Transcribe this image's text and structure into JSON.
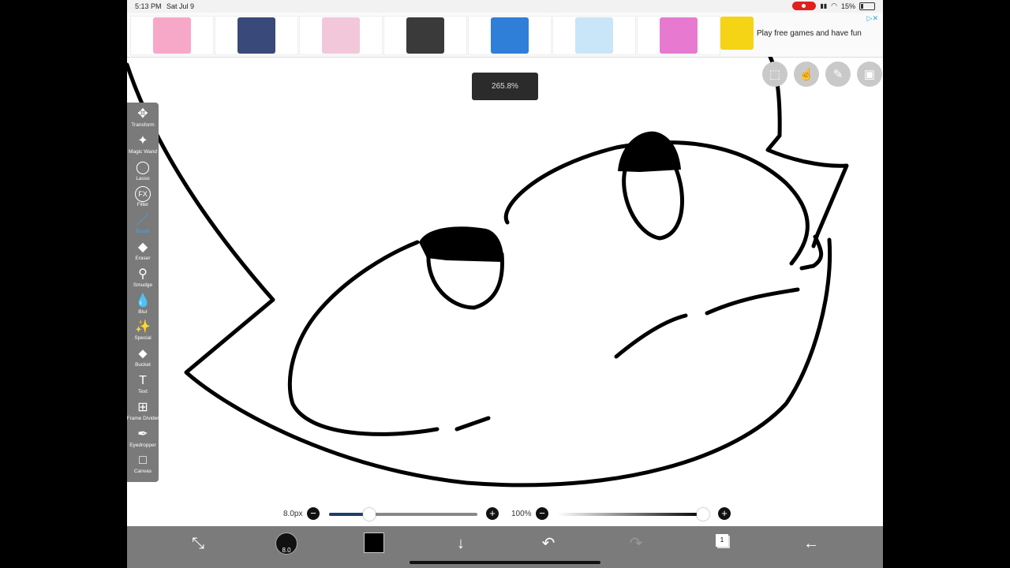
{
  "status": {
    "time": "5:13 PM",
    "date": "Sat Jul 9",
    "battery": "15%"
  },
  "ad": {
    "text": "Play free games and have fun",
    "info_glyph": "▷✕",
    "thumbs": [
      {
        "name": "peppa-pig-game",
        "color": "#f7a8c8"
      },
      {
        "name": "ladybug-game",
        "color": "#394a7a"
      },
      {
        "name": "dolls-game",
        "color": "#f2c7d9"
      },
      {
        "name": "dino-game",
        "color": "#3a3a3a"
      },
      {
        "name": "penguin-game",
        "color": "#2f7fd8"
      },
      {
        "name": "water-glass-game",
        "color": "#c8e6f7"
      },
      {
        "name": "house-game",
        "color": "#e77ad0"
      }
    ]
  },
  "canvas": {
    "zoom": "265.8%"
  },
  "topright": [
    {
      "name": "selection-icon",
      "glyph": "⬚"
    },
    {
      "name": "hand-icon",
      "glyph": "☝"
    },
    {
      "name": "pencil-icon",
      "glyph": "✎"
    },
    {
      "name": "image-icon",
      "glyph": "▣"
    }
  ],
  "tools": [
    {
      "id": "transform",
      "label": "Transform",
      "icon": "✥"
    },
    {
      "id": "magic-wand",
      "label": "Magic Wand",
      "icon": "✦"
    },
    {
      "id": "lasso",
      "label": "Lasso",
      "icon": "◯"
    },
    {
      "id": "filter",
      "label": "Filter",
      "icon": "FX"
    },
    {
      "id": "brush",
      "label": "Brush",
      "icon": "／"
    },
    {
      "id": "eraser",
      "label": "Eraser",
      "icon": "◆"
    },
    {
      "id": "smudge",
      "label": "Smudge",
      "icon": "⚲"
    },
    {
      "id": "blur",
      "label": "Blur",
      "icon": "💧"
    },
    {
      "id": "special",
      "label": "Special",
      "icon": "✨"
    },
    {
      "id": "bucket",
      "label": "Bucket",
      "icon": "⬥"
    },
    {
      "id": "text",
      "label": "Text",
      "icon": "T"
    },
    {
      "id": "frame-divider",
      "label": "Frame Divider",
      "icon": "⊞"
    },
    {
      "id": "eyedropper",
      "label": "Eyedropper",
      "icon": "✒"
    },
    {
      "id": "canvas",
      "label": "Canvas",
      "icon": "□"
    }
  ],
  "active_tool": "brush",
  "brush": {
    "size": "8.0px",
    "size_fraction": 0.27,
    "opacity": "100%",
    "opacity_fraction": 1.0,
    "minus": "−",
    "plus": "+",
    "accent": "#1c3f66"
  },
  "bottom": {
    "brush_size_badge": "8.0",
    "layer_count": "1",
    "icons": {
      "edit": "⤡",
      "download": "↓",
      "undo": "↶",
      "redo": "↷",
      "back": "←"
    }
  }
}
